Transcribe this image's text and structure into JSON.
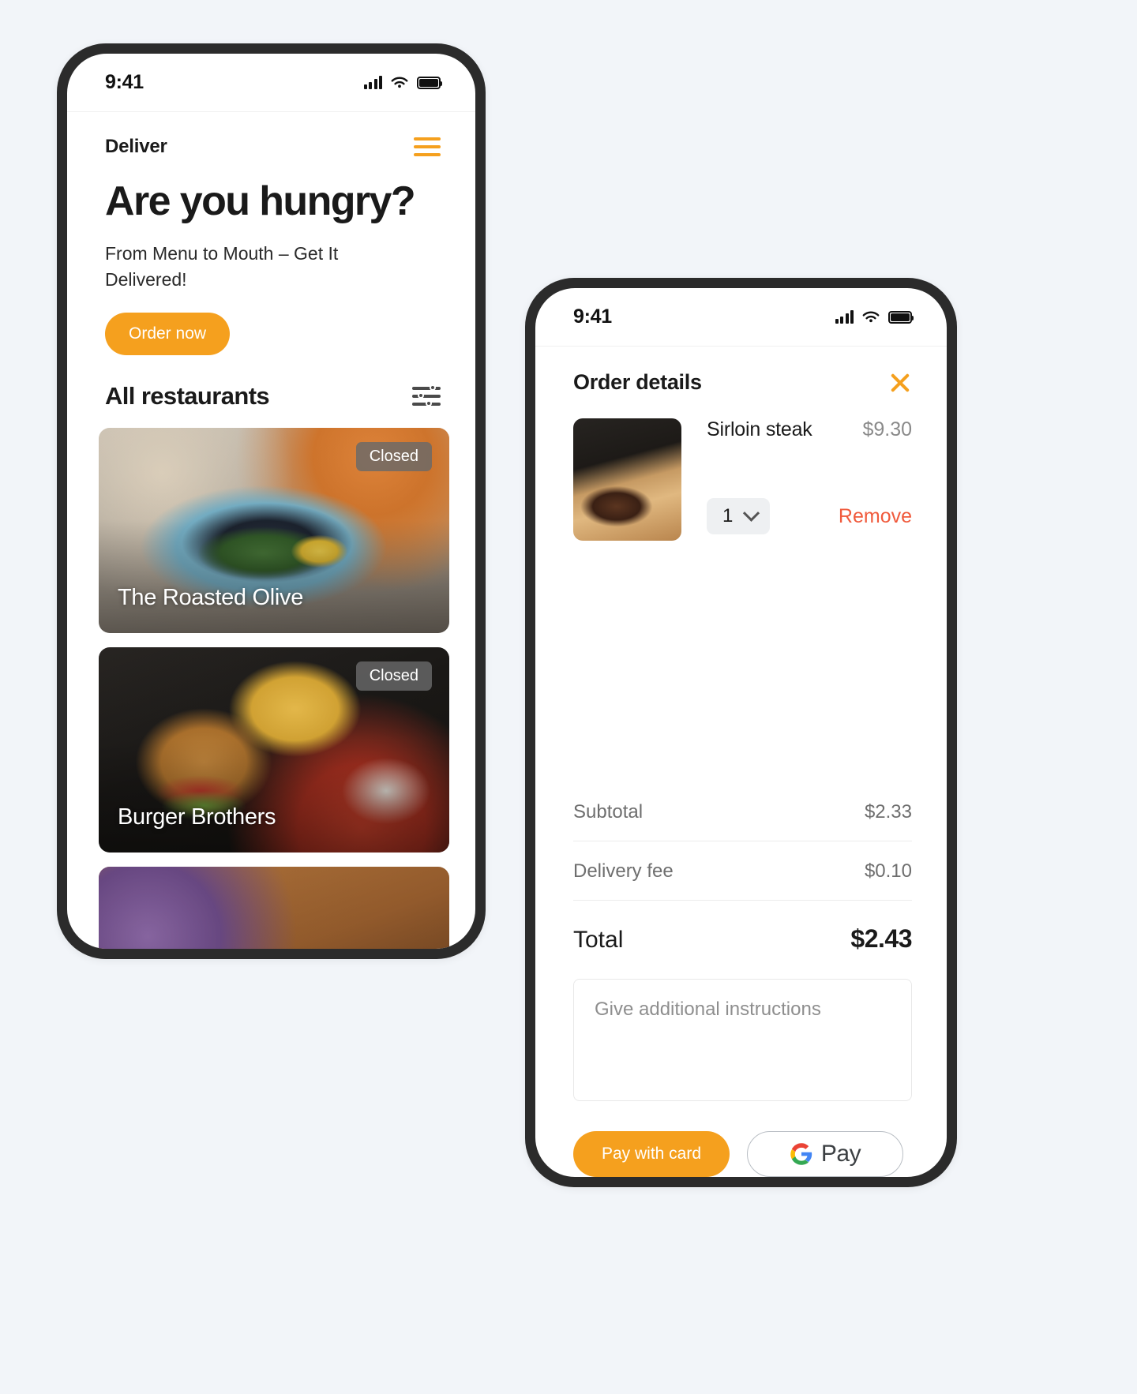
{
  "colors": {
    "accent_orange": "#f5a01e",
    "remove_red": "#f05a3c",
    "page_bg": "#f2f5f9",
    "phone_frame": "#2b2b2b",
    "badge_gray": "#696969"
  },
  "left_phone": {
    "status_bar": {
      "time": "9:41",
      "signal_icon": "signal-bars-icon",
      "wifi_icon": "wifi-icon",
      "battery_icon": "battery-full-icon"
    },
    "brand": "Deliver",
    "menu_icon": "hamburger-menu-icon",
    "hero": {
      "title": "Are you hungry?",
      "subtitle": "From Menu to Mouth – Get It Delivered!",
      "cta_label": "Order now"
    },
    "section": {
      "title": "All restaurants",
      "filter_icon": "filter-sliders-icon"
    },
    "restaurants": [
      {
        "name": "The Roasted Olive",
        "status": "Closed",
        "image": "mussels-plate-photo"
      },
      {
        "name": "Burger Brothers",
        "status": "Closed",
        "image": "burger-and-fries-photo"
      },
      {
        "name": "",
        "status": "",
        "image": "steak-board-photo"
      }
    ]
  },
  "right_phone": {
    "status_bar": {
      "time": "9:41",
      "signal_icon": "signal-bars-icon",
      "wifi_icon": "wifi-icon",
      "battery_icon": "battery-full-icon"
    },
    "header": {
      "title": "Order details",
      "close_icon": "close-x-icon"
    },
    "item": {
      "thumbnail": "sirloin-steak-photo",
      "name": "Sirloin steak",
      "price": "$9.30",
      "quantity": "1",
      "quantity_chevron_icon": "chevron-down-icon",
      "remove_label": "Remove"
    },
    "totals": [
      {
        "label": "Subtotal",
        "value": "$2.33"
      },
      {
        "label": "Delivery fee",
        "value": "$0.10"
      }
    ],
    "grand_total": {
      "label": "Total",
      "value": "$2.43"
    },
    "notes": {
      "value": "",
      "placeholder": "Give additional instructions"
    },
    "payment": {
      "card_label": "Pay with card",
      "gpay_label": "Pay",
      "gpay_icon": "google-g-icon"
    }
  }
}
